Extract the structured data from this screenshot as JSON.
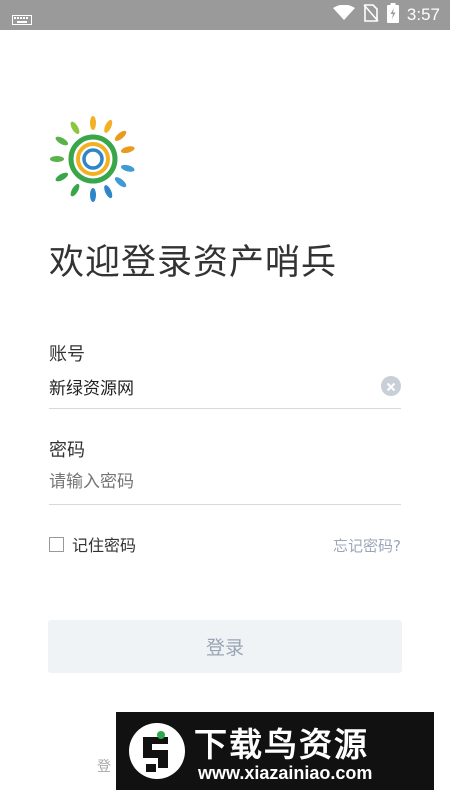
{
  "status_bar": {
    "time": "3:57",
    "icons": [
      "keyboard-icon",
      "wifi-icon",
      "no-sim-icon",
      "battery-icon"
    ]
  },
  "app": {
    "title": "欢迎登录资产哨兵"
  },
  "form": {
    "account_label": "账号",
    "account_value": "新绿资源网",
    "password_label": "密码",
    "password_placeholder": "请输入密码",
    "remember_label": "记住密码",
    "remember_checked": false,
    "forgot_label": "忘记密码?",
    "login_button": "登录"
  },
  "footer": {
    "hint_visible": "登"
  },
  "watermark": {
    "brand": "下载鸟资源",
    "url": "www.xiazainiao.com"
  },
  "colors": {
    "accent_muted": "#9aa4b5",
    "button_bg": "#f0f3f6",
    "status_bar": "#9a9a9a"
  }
}
